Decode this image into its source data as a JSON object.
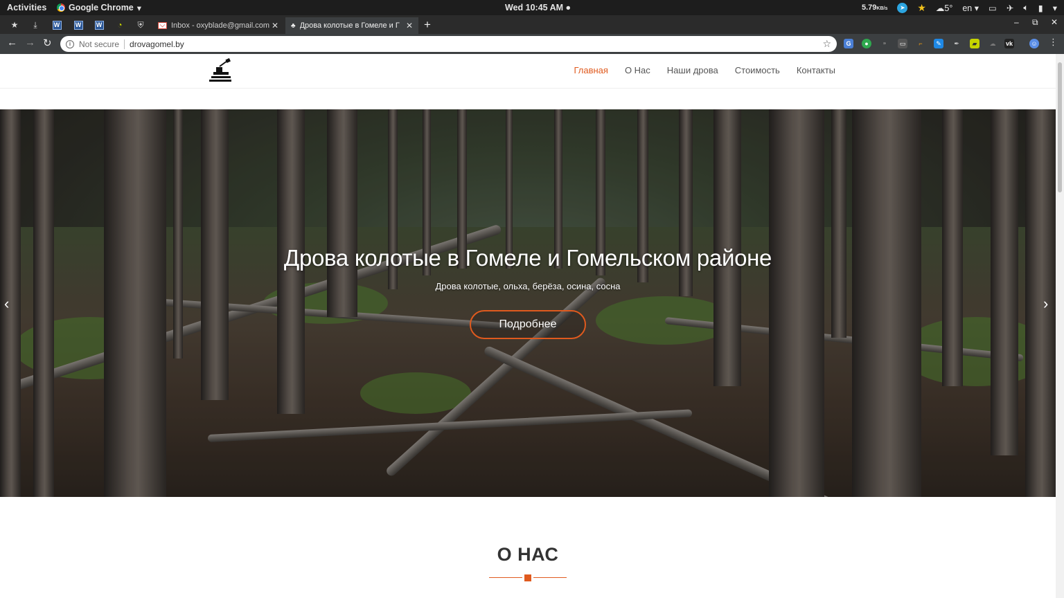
{
  "system_bar": {
    "activities": "Activities",
    "app_name": "Google Chrome",
    "clock": "Wed 10:45 AM",
    "net_speed": "5.79",
    "net_unit": "KB/s",
    "weather": "5°",
    "language": "en"
  },
  "tabs": [
    {
      "title": "Inbox - oxyblade@gmail.com",
      "active": false
    },
    {
      "title": "Дрова колотые в Гомеле и Г",
      "active": true
    }
  ],
  "pinned_tabs": [
    "W",
    "W",
    "W"
  ],
  "address_bar": {
    "security": "Not secure",
    "url": "drovagomel.by"
  },
  "site": {
    "nav": [
      {
        "label": "Главная",
        "active": true
      },
      {
        "label": "О Нас",
        "active": false
      },
      {
        "label": "Наши дрова",
        "active": false
      },
      {
        "label": "Стоимость",
        "active": false
      },
      {
        "label": "Контакты",
        "active": false
      }
    ],
    "hero": {
      "title": "Дрова колотые в Гомеле и Гомельском районе",
      "subtitle": "Дрова колотые, ольха, берёза, осина, сосна",
      "button": "Подробнее",
      "slide_progress": 0.775
    },
    "about": {
      "title": "О НАС"
    }
  },
  "colors": {
    "accent": "#e05a1e"
  }
}
